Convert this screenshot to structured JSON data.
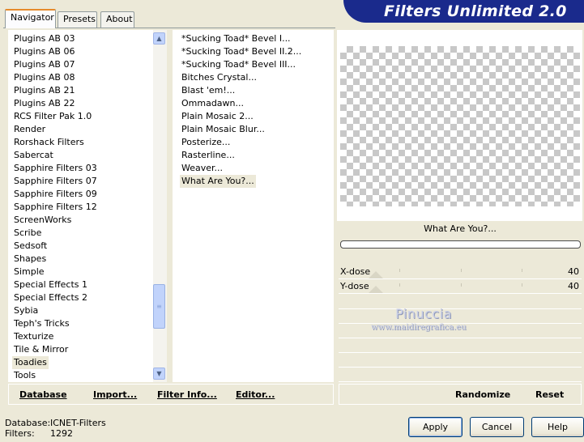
{
  "tabs": [
    {
      "label": "Navigator"
    },
    {
      "label": "Presets"
    },
    {
      "label": "About"
    }
  ],
  "app_title": "Filters Unlimited 2.0",
  "categories": [
    "Plugins AB 03",
    "Plugins AB 06",
    "Plugins AB 07",
    "Plugins AB 08",
    "Plugins AB 21",
    "Plugins AB 22",
    "RCS Filter Pak 1.0",
    "Render",
    "Rorshack Filters",
    "Sabercat",
    "Sapphire Filters 03",
    "Sapphire Filters 07",
    "Sapphire Filters 09",
    "Sapphire Filters 12",
    "ScreenWorks",
    "Scribe",
    "Sedsoft",
    "Shapes",
    "Simple",
    "Special Effects 1",
    "Special Effects 2",
    "Sybia",
    "Teph's Tricks",
    "Texturize",
    "Tile & Mirror",
    "Toadies",
    "Tools"
  ],
  "selected_category": "Toadies",
  "filters": [
    "*Sucking Toad*  Bevel I...",
    "*Sucking Toad*  Bevel II.2...",
    "*Sucking Toad*  Bevel III...",
    "Bitches Crystal...",
    "Blast 'em!...",
    "Ommadawn...",
    "Plain Mosaic 2...",
    "Plain Mosaic Blur...",
    "Posterize...",
    "Rasterline...",
    "Weaver...",
    "What Are You?..."
  ],
  "selected_filter": "What Are You?...",
  "preview": {
    "filter_name": "What Are You?...",
    "progress": 0
  },
  "sliders": [
    {
      "label": "X-dose",
      "value": "40"
    },
    {
      "label": "Y-dose",
      "value": "40"
    }
  ],
  "watermark": {
    "name": "Pinuccia",
    "site": "www.maidiregrafica.eu"
  },
  "toolbar": {
    "database": "Database",
    "import": "Import...",
    "filter_info": "Filter Info...",
    "editor": "Editor...",
    "randomize": "Randomize",
    "reset": "Reset"
  },
  "status": {
    "database_label": "Database:",
    "database_value": "ICNET-Filters",
    "filters_label": "Filters:",
    "filters_value": "1292"
  },
  "buttons": {
    "apply": "Apply",
    "cancel": "Cancel",
    "help": "Help"
  },
  "colors": {
    "banner": "#1a2a8c",
    "window_bg": "#ece9d8",
    "selection": "#ece9d8"
  }
}
